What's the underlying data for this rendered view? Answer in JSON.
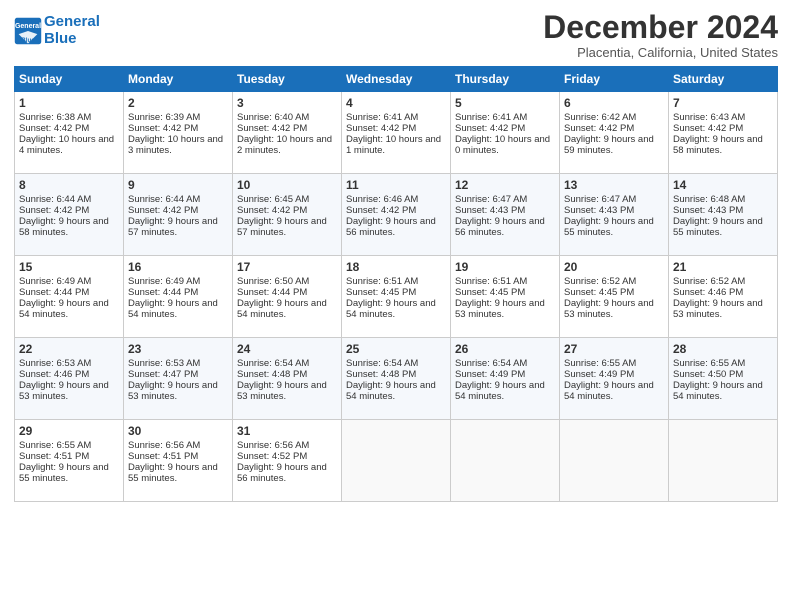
{
  "header": {
    "logo_line1": "General",
    "logo_line2": "Blue",
    "month_title": "December 2024",
    "location": "Placentia, California, United States"
  },
  "days_of_week": [
    "Sunday",
    "Monday",
    "Tuesday",
    "Wednesday",
    "Thursday",
    "Friday",
    "Saturday"
  ],
  "weeks": [
    [
      {
        "day": "1",
        "sunrise": "Sunrise: 6:38 AM",
        "sunset": "Sunset: 4:42 PM",
        "daylight": "Daylight: 10 hours and 4 minutes."
      },
      {
        "day": "2",
        "sunrise": "Sunrise: 6:39 AM",
        "sunset": "Sunset: 4:42 PM",
        "daylight": "Daylight: 10 hours and 3 minutes."
      },
      {
        "day": "3",
        "sunrise": "Sunrise: 6:40 AM",
        "sunset": "Sunset: 4:42 PM",
        "daylight": "Daylight: 10 hours and 2 minutes."
      },
      {
        "day": "4",
        "sunrise": "Sunrise: 6:41 AM",
        "sunset": "Sunset: 4:42 PM",
        "daylight": "Daylight: 10 hours and 1 minute."
      },
      {
        "day": "5",
        "sunrise": "Sunrise: 6:41 AM",
        "sunset": "Sunset: 4:42 PM",
        "daylight": "Daylight: 10 hours and 0 minutes."
      },
      {
        "day": "6",
        "sunrise": "Sunrise: 6:42 AM",
        "sunset": "Sunset: 4:42 PM",
        "daylight": "Daylight: 9 hours and 59 minutes."
      },
      {
        "day": "7",
        "sunrise": "Sunrise: 6:43 AM",
        "sunset": "Sunset: 4:42 PM",
        "daylight": "Daylight: 9 hours and 58 minutes."
      }
    ],
    [
      {
        "day": "8",
        "sunrise": "Sunrise: 6:44 AM",
        "sunset": "Sunset: 4:42 PM",
        "daylight": "Daylight: 9 hours and 58 minutes."
      },
      {
        "day": "9",
        "sunrise": "Sunrise: 6:44 AM",
        "sunset": "Sunset: 4:42 PM",
        "daylight": "Daylight: 9 hours and 57 minutes."
      },
      {
        "day": "10",
        "sunrise": "Sunrise: 6:45 AM",
        "sunset": "Sunset: 4:42 PM",
        "daylight": "Daylight: 9 hours and 57 minutes."
      },
      {
        "day": "11",
        "sunrise": "Sunrise: 6:46 AM",
        "sunset": "Sunset: 4:42 PM",
        "daylight": "Daylight: 9 hours and 56 minutes."
      },
      {
        "day": "12",
        "sunrise": "Sunrise: 6:47 AM",
        "sunset": "Sunset: 4:43 PM",
        "daylight": "Daylight: 9 hours and 56 minutes."
      },
      {
        "day": "13",
        "sunrise": "Sunrise: 6:47 AM",
        "sunset": "Sunset: 4:43 PM",
        "daylight": "Daylight: 9 hours and 55 minutes."
      },
      {
        "day": "14",
        "sunrise": "Sunrise: 6:48 AM",
        "sunset": "Sunset: 4:43 PM",
        "daylight": "Daylight: 9 hours and 55 minutes."
      }
    ],
    [
      {
        "day": "15",
        "sunrise": "Sunrise: 6:49 AM",
        "sunset": "Sunset: 4:44 PM",
        "daylight": "Daylight: 9 hours and 54 minutes."
      },
      {
        "day": "16",
        "sunrise": "Sunrise: 6:49 AM",
        "sunset": "Sunset: 4:44 PM",
        "daylight": "Daylight: 9 hours and 54 minutes."
      },
      {
        "day": "17",
        "sunrise": "Sunrise: 6:50 AM",
        "sunset": "Sunset: 4:44 PM",
        "daylight": "Daylight: 9 hours and 54 minutes."
      },
      {
        "day": "18",
        "sunrise": "Sunrise: 6:51 AM",
        "sunset": "Sunset: 4:45 PM",
        "daylight": "Daylight: 9 hours and 54 minutes."
      },
      {
        "day": "19",
        "sunrise": "Sunrise: 6:51 AM",
        "sunset": "Sunset: 4:45 PM",
        "daylight": "Daylight: 9 hours and 53 minutes."
      },
      {
        "day": "20",
        "sunrise": "Sunrise: 6:52 AM",
        "sunset": "Sunset: 4:45 PM",
        "daylight": "Daylight: 9 hours and 53 minutes."
      },
      {
        "day": "21",
        "sunrise": "Sunrise: 6:52 AM",
        "sunset": "Sunset: 4:46 PM",
        "daylight": "Daylight: 9 hours and 53 minutes."
      }
    ],
    [
      {
        "day": "22",
        "sunrise": "Sunrise: 6:53 AM",
        "sunset": "Sunset: 4:46 PM",
        "daylight": "Daylight: 9 hours and 53 minutes."
      },
      {
        "day": "23",
        "sunrise": "Sunrise: 6:53 AM",
        "sunset": "Sunset: 4:47 PM",
        "daylight": "Daylight: 9 hours and 53 minutes."
      },
      {
        "day": "24",
        "sunrise": "Sunrise: 6:54 AM",
        "sunset": "Sunset: 4:48 PM",
        "daylight": "Daylight: 9 hours and 53 minutes."
      },
      {
        "day": "25",
        "sunrise": "Sunrise: 6:54 AM",
        "sunset": "Sunset: 4:48 PM",
        "daylight": "Daylight: 9 hours and 54 minutes."
      },
      {
        "day": "26",
        "sunrise": "Sunrise: 6:54 AM",
        "sunset": "Sunset: 4:49 PM",
        "daylight": "Daylight: 9 hours and 54 minutes."
      },
      {
        "day": "27",
        "sunrise": "Sunrise: 6:55 AM",
        "sunset": "Sunset: 4:49 PM",
        "daylight": "Daylight: 9 hours and 54 minutes."
      },
      {
        "day": "28",
        "sunrise": "Sunrise: 6:55 AM",
        "sunset": "Sunset: 4:50 PM",
        "daylight": "Daylight: 9 hours and 54 minutes."
      }
    ],
    [
      {
        "day": "29",
        "sunrise": "Sunrise: 6:55 AM",
        "sunset": "Sunset: 4:51 PM",
        "daylight": "Daylight: 9 hours and 55 minutes."
      },
      {
        "day": "30",
        "sunrise": "Sunrise: 6:56 AM",
        "sunset": "Sunset: 4:51 PM",
        "daylight": "Daylight: 9 hours and 55 minutes."
      },
      {
        "day": "31",
        "sunrise": "Sunrise: 6:56 AM",
        "sunset": "Sunset: 4:52 PM",
        "daylight": "Daylight: 9 hours and 56 minutes."
      },
      null,
      null,
      null,
      null
    ]
  ]
}
